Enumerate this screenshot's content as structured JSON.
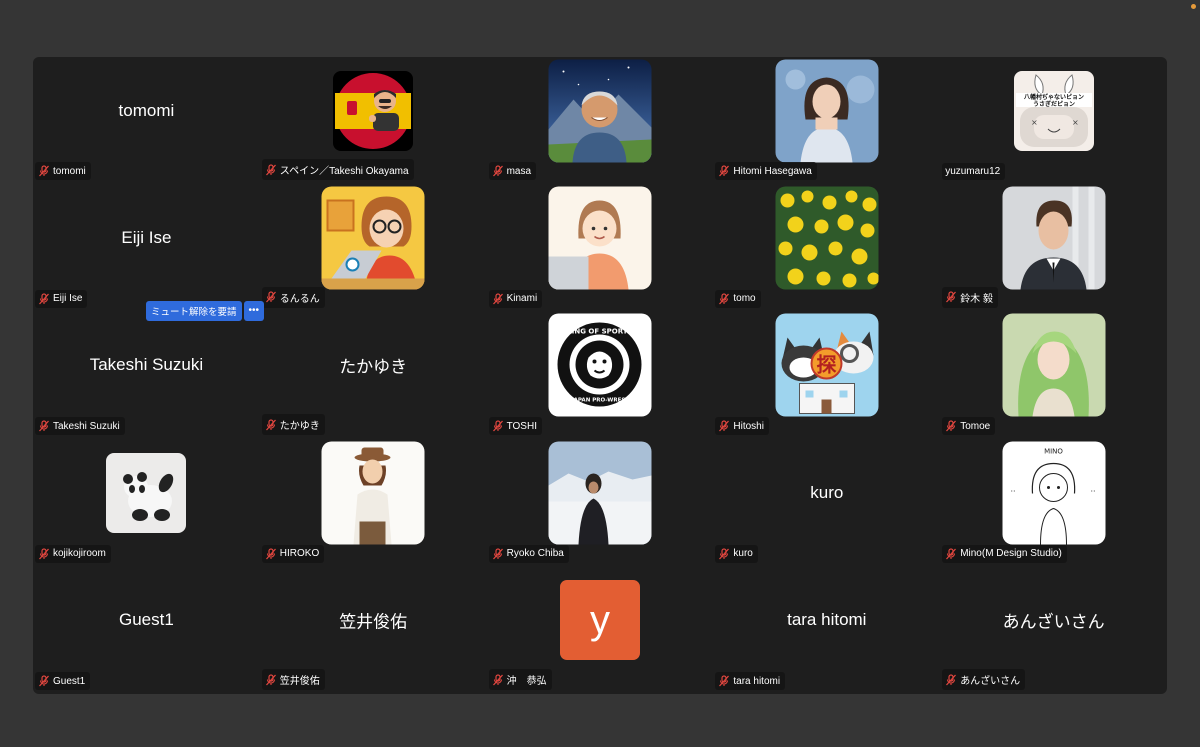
{
  "participants": [
    {
      "name": "tomomi",
      "display": "tomomi"
    },
    {
      "name": "スペイン／Takeshi Okayama",
      "icon": "spain-flag-memoji-avatar"
    },
    {
      "name": "masa",
      "icon": "smiling-man-mountains-avatar"
    },
    {
      "name": "Hitomi Hasegawa",
      "icon": "woman-portrait-avatar"
    },
    {
      "name": "yuzumaru12",
      "icon": "rabbit-character-avatar",
      "avatar_text": "八幡村ぢゃないピョン うさぎだピョン"
    },
    {
      "name": "Eiji Ise",
      "display": "Eiji Ise"
    },
    {
      "name": "るんるん",
      "icon": "woman-laptop-illustration-avatar"
    },
    {
      "name": "Kinami",
      "icon": "girl-laptop-illustration-avatar"
    },
    {
      "name": "tomo",
      "icon": "yellow-flowers-avatar"
    },
    {
      "name": "鈴木 毅",
      "icon": "man-in-suit-avatar"
    },
    {
      "name": "Takeshi Suzuki",
      "display": "Takeshi Suzuki",
      "unmute_request": "ミュート解除を要請",
      "more": "•••"
    },
    {
      "name": "たかゆき",
      "display": "たかゆき"
    },
    {
      "name": "TOSHI",
      "icon": "lion-wrestling-logo-avatar",
      "avatar_text": "KING OF SPORTS NEW JAPAN PRO-WRESTLING"
    },
    {
      "name": "Hitoshi",
      "icon": "cats-detective-hospital-avatar",
      "avatar_text": "探"
    },
    {
      "name": "Tomoe",
      "icon": "green-hair-woman-avatar"
    },
    {
      "name": "kojikojiroom",
      "icon": "panda-toy-avatar"
    },
    {
      "name": "HIROKO",
      "icon": "man-with-hat-illustration-avatar"
    },
    {
      "name": "Ryoko Chiba",
      "icon": "snow-landscape-person-avatar"
    },
    {
      "name": "kuro",
      "display": "kuro"
    },
    {
      "name": "Mino(M Design Studio)",
      "icon": "girl-sketch-avatar",
      "avatar_text": "MINO"
    },
    {
      "name": "Guest1",
      "display": "Guest1"
    },
    {
      "name": "笠井俊佑",
      "display": "笠井俊佑"
    },
    {
      "name": "沖　恭弘",
      "letter": "y",
      "letter_color": "#e35e33"
    },
    {
      "name": "tara hitomi",
      "display": "tara hitomi"
    },
    {
      "name": "あんざいさん",
      "display": "あんざいさん"
    }
  ],
  "colors": {
    "window_bg": "#353535",
    "grid_bg": "#1e1e1e",
    "accent": "#2f6bdc",
    "muted_red": "#e0463f"
  }
}
